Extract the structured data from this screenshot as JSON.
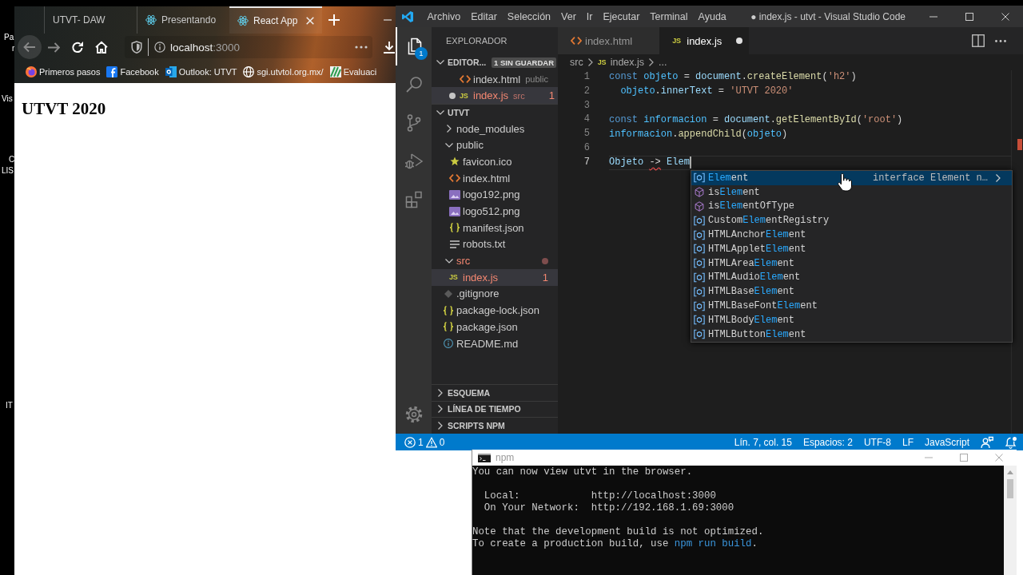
{
  "desktop": {
    "labels": [
      "Pa",
      "r",
      "Vis",
      "C",
      "LIS",
      "IT"
    ]
  },
  "browser": {
    "tabs": [
      {
        "label": "UTVT- DAW",
        "kind": "plain",
        "selected": false
      },
      {
        "label": "Presentando",
        "kind": "app",
        "selected": false
      },
      {
        "label": "React App",
        "kind": "app",
        "selected": true
      }
    ],
    "address": {
      "host": "localhost",
      "port": ":3000"
    },
    "bookmarks": [
      {
        "label": "Primeros pasos",
        "kind": "guide"
      },
      {
        "label": "Facebook",
        "kind": "social"
      },
      {
        "label": "Outlook: UTVT",
        "kind": "mail"
      },
      {
        "label": "sgi.utvtol.org.mx/",
        "kind": "site"
      },
      {
        "label": "Evaluaci",
        "kind": "app"
      }
    ],
    "page": {
      "heading": "UTVT 2020"
    }
  },
  "vscode": {
    "menu": [
      "Archivo",
      "Editar",
      "Selección",
      "Ver",
      "Ir",
      "Ejecutar",
      "Terminal",
      "Ayuda"
    ],
    "title": "● index.js - utvt - Visual Studio Code",
    "activity": [
      {
        "kind": "explorer",
        "selected": true,
        "badge": "1"
      },
      {
        "kind": "search",
        "selected": false
      },
      {
        "kind": "source_control",
        "selected": false
      },
      {
        "kind": "run",
        "selected": false
      },
      {
        "kind": "extensions",
        "selected": false
      }
    ],
    "explorer": {
      "title": "EXPLORADOR",
      "open_editors": {
        "label": "EDITOR...",
        "badge": "1 SIN GUARDAR",
        "expanded": true,
        "items": [
          {
            "name": "index.html",
            "folder": "public",
            "kind": "html",
            "modified": false,
            "error": false,
            "selected": false
          },
          {
            "name": "index.js",
            "folder": "src",
            "kind": "js",
            "icon_text": "JS",
            "modified": true,
            "error": true,
            "count": "1",
            "selected": true
          }
        ]
      },
      "project": {
        "label": "UTVT",
        "expanded": true,
        "children": [
          {
            "name": "node_modules",
            "kind": "folder",
            "expanded": false,
            "error": false,
            "selected": false
          },
          {
            "name": "public",
            "kind": "folder",
            "expanded": true,
            "error": false,
            "selected": false,
            "children": [
              {
                "name": "favicon.ico",
                "kind": "favicon",
                "error": false,
                "selected": false
              },
              {
                "name": "index.html",
                "kind": "html",
                "error": false,
                "selected": false
              },
              {
                "name": "logo192.png",
                "kind": "image",
                "error": false,
                "selected": false
              },
              {
                "name": "logo512.png",
                "kind": "image",
                "error": false,
                "selected": false
              },
              {
                "name": "manifest.json",
                "kind": "json",
                "error": false,
                "selected": false
              },
              {
                "name": "robots.txt",
                "kind": "text",
                "error": false,
                "selected": false
              }
            ]
          },
          {
            "name": "src",
            "kind": "folder",
            "expanded": true,
            "error": true,
            "selected": false,
            "children": [
              {
                "name": "index.js",
                "kind": "js",
                "icon_text": "JS",
                "error": true,
                "count": "1",
                "selected": true
              }
            ]
          },
          {
            "name": ".gitignore",
            "kind": "git",
            "error": false,
            "selected": false
          },
          {
            "name": "package-lock.json",
            "kind": "json",
            "error": false,
            "selected": false
          },
          {
            "name": "package.json",
            "kind": "json",
            "error": false,
            "selected": false
          },
          {
            "name": "README.md",
            "kind": "info",
            "error": false,
            "selected": false
          }
        ]
      },
      "panels": [
        {
          "label": "ESQUEMA",
          "expanded": false
        },
        {
          "label": "LÍNEA DE TIEMPO",
          "expanded": false
        },
        {
          "label": "SCRIPTS NPM",
          "expanded": false
        }
      ]
    },
    "tabs": [
      {
        "label": "index.html",
        "kind": "html",
        "selected": false,
        "modified": false
      },
      {
        "label": "index.js",
        "kind": "js",
        "icon_text": "JS",
        "selected": true,
        "modified": true
      }
    ],
    "breadcrumb": [
      {
        "label": "src"
      },
      {
        "label": "index.js",
        "icon_text": "JS"
      },
      {
        "label": "..."
      }
    ],
    "code": [
      {
        "number": "1",
        "current": false,
        "tokens": [
          {
            "kind": "keyword",
            "text": "const "
          },
          {
            "kind": "constant",
            "text": "objeto"
          },
          {
            "kind": "plain",
            "text": " = "
          },
          {
            "kind": "variable",
            "text": "document"
          },
          {
            "kind": "plain",
            "text": "."
          },
          {
            "kind": "function",
            "text": "createElement"
          },
          {
            "kind": "plain",
            "text": "("
          },
          {
            "kind": "string",
            "text": "'h2'"
          },
          {
            "kind": "plain",
            "text": ")"
          }
        ]
      },
      {
        "number": "2",
        "current": false,
        "tokens": [
          {
            "kind": "constant",
            "text": "  objeto"
          },
          {
            "kind": "plain",
            "text": "."
          },
          {
            "kind": "variable",
            "text": "innerText"
          },
          {
            "kind": "plain",
            "text": " = "
          },
          {
            "kind": "string",
            "text": "'UTVT 2020'"
          }
        ]
      },
      {
        "number": "3",
        "current": false
      },
      {
        "number": "4",
        "current": false,
        "tokens": [
          {
            "kind": "keyword",
            "text": "const "
          },
          {
            "kind": "constant",
            "text": "informacion"
          },
          {
            "kind": "plain",
            "text": " = "
          },
          {
            "kind": "variable",
            "text": "document"
          },
          {
            "kind": "plain",
            "text": "."
          },
          {
            "kind": "function",
            "text": "getElementById"
          },
          {
            "kind": "plain",
            "text": "("
          },
          {
            "kind": "string",
            "text": "'root'"
          },
          {
            "kind": "plain",
            "text": ")"
          }
        ]
      },
      {
        "number": "5",
        "current": false,
        "tokens": [
          {
            "kind": "constant",
            "text": "informacion"
          },
          {
            "kind": "plain",
            "text": "."
          },
          {
            "kind": "function",
            "text": "appendChild"
          },
          {
            "kind": "plain",
            "text": "("
          },
          {
            "kind": "constant",
            "text": "objeto"
          },
          {
            "kind": "plain",
            "text": ")"
          }
        ]
      },
      {
        "number": "6",
        "current": false
      },
      {
        "number": "7",
        "current": true,
        "tokens": [
          {
            "kind": "variable",
            "text": "Objeto "
          },
          {
            "kind": "invalid",
            "text": "->"
          },
          {
            "kind": "variable",
            "text": " Elem"
          }
        ]
      }
    ],
    "suggestions": [
      {
        "kind": "variable",
        "selected": true,
        "parts": [
          {
            "text": "Elem",
            "match": true
          },
          {
            "text": "ent",
            "match": false
          }
        ],
        "detail": "interface Element n…"
      },
      {
        "kind": "method",
        "selected": false,
        "parts": [
          {
            "text": "is",
            "match": false
          },
          {
            "text": "Elem",
            "match": true
          },
          {
            "text": "ent",
            "match": false
          }
        ]
      },
      {
        "kind": "method",
        "selected": false,
        "parts": [
          {
            "text": "is",
            "match": false
          },
          {
            "text": "Elem",
            "match": true
          },
          {
            "text": "entOfType",
            "match": false
          }
        ]
      },
      {
        "kind": "variable",
        "selected": false,
        "parts": [
          {
            "text": "Custom",
            "match": false
          },
          {
            "text": "Elem",
            "match": true
          },
          {
            "text": "entRegistry",
            "match": false
          }
        ]
      },
      {
        "kind": "variable",
        "selected": false,
        "parts": [
          {
            "text": "HTMLAnchor",
            "match": false
          },
          {
            "text": "Elem",
            "match": true
          },
          {
            "text": "ent",
            "match": false
          }
        ]
      },
      {
        "kind": "variable",
        "selected": false,
        "parts": [
          {
            "text": "HTMLApplet",
            "match": false
          },
          {
            "text": "Elem",
            "match": true
          },
          {
            "text": "ent",
            "match": false
          }
        ]
      },
      {
        "kind": "variable",
        "selected": false,
        "parts": [
          {
            "text": "HTMLArea",
            "match": false
          },
          {
            "text": "Elem",
            "match": true
          },
          {
            "text": "ent",
            "match": false
          }
        ]
      },
      {
        "kind": "variable",
        "selected": false,
        "parts": [
          {
            "text": "HTMLAudio",
            "match": false
          },
          {
            "text": "Elem",
            "match": true
          },
          {
            "text": "ent",
            "match": false
          }
        ]
      },
      {
        "kind": "variable",
        "selected": false,
        "parts": [
          {
            "text": "HTMLBase",
            "match": false
          },
          {
            "text": "Elem",
            "match": true
          },
          {
            "text": "ent",
            "match": false
          }
        ]
      },
      {
        "kind": "variable",
        "selected": false,
        "parts": [
          {
            "text": "HTMLBaseFont",
            "match": false
          },
          {
            "text": "Elem",
            "match": true
          },
          {
            "text": "ent",
            "match": false
          }
        ]
      },
      {
        "kind": "variable",
        "selected": false,
        "parts": [
          {
            "text": "HTMLBody",
            "match": false
          },
          {
            "text": "Elem",
            "match": true
          },
          {
            "text": "ent",
            "match": false
          }
        ]
      },
      {
        "kind": "variable",
        "selected": false,
        "parts": [
          {
            "text": "HTMLButton",
            "match": false
          },
          {
            "text": "Elem",
            "match": true
          },
          {
            "text": "ent",
            "match": false
          }
        ]
      }
    ],
    "status_bar": {
      "errors": "1",
      "warnings": "0",
      "items": [
        "Lín. 7, col. 15",
        "Espacios: 2",
        "UTF-8",
        "LF",
        "JavaScript"
      ]
    }
  },
  "terminal": {
    "title": "npm",
    "paragraphs": [
      {
        "lines": [
          {
            "parts": [
              {
                "kind": "plain",
                "text": "You can now view utvt in the browser."
              }
            ]
          }
        ]
      },
      {
        "lines": [
          {
            "parts": [
              {
                "kind": "plain",
                "text": "  Local:            http://localhost:3000"
              }
            ]
          },
          {
            "parts": [
              {
                "kind": "plain",
                "text": "  On Your Network:  http://192.168.1.69:3000"
              }
            ]
          }
        ]
      },
      {
        "lines": [
          {
            "parts": [
              {
                "kind": "plain",
                "text": "Note that the development build is not optimized."
              }
            ]
          },
          {
            "parts": [
              {
                "kind": "plain",
                "text": "To create a production build, use "
              },
              {
                "kind": "command",
                "text": "npm run build"
              },
              {
                "kind": "plain",
                "text": "."
              }
            ]
          }
        ]
      }
    ]
  }
}
